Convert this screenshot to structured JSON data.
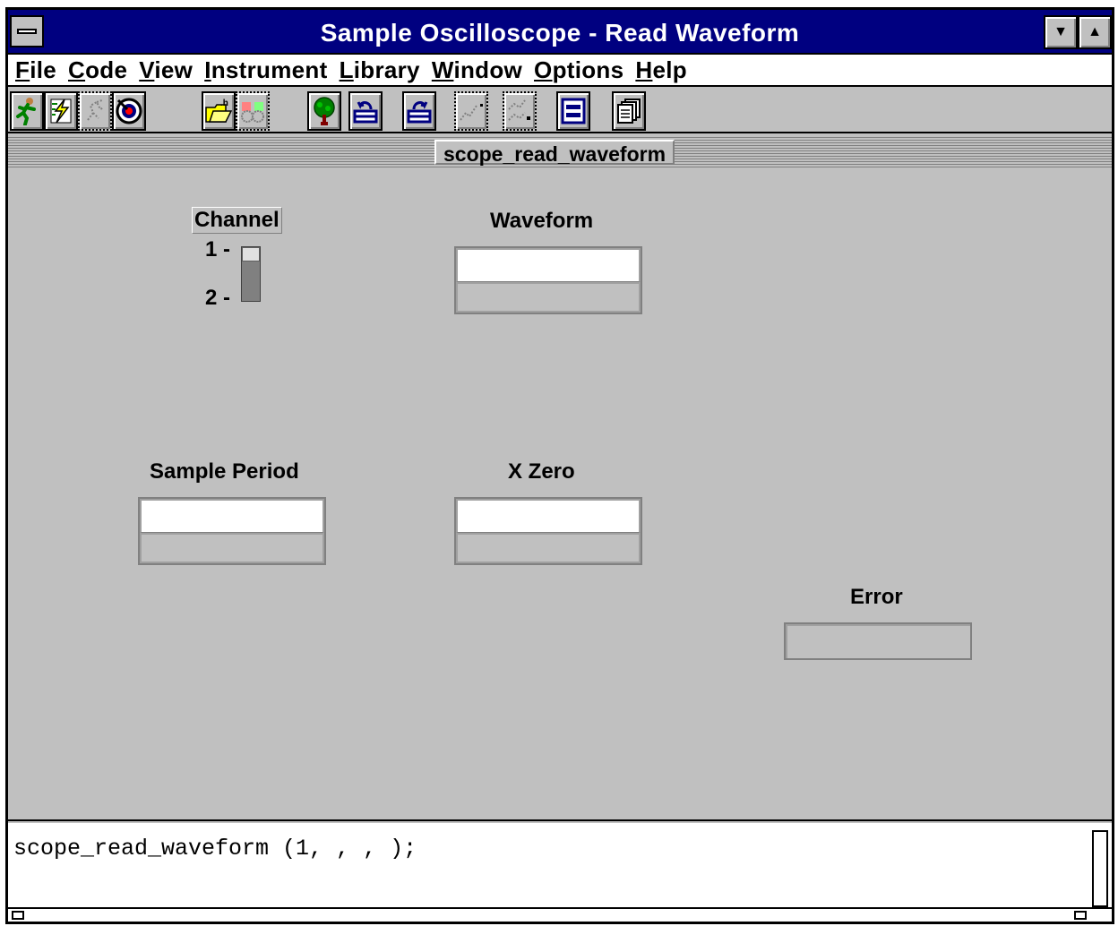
{
  "window": {
    "title": "Sample Oscilloscope - Read Waveform"
  },
  "menubar": {
    "items": [
      {
        "underline": "F",
        "rest": "ile"
      },
      {
        "underline": "C",
        "rest": "ode"
      },
      {
        "underline": "V",
        "rest": "iew"
      },
      {
        "underline": "I",
        "rest": "nstrument"
      },
      {
        "underline": "L",
        "rest": "ibrary"
      },
      {
        "underline": "W",
        "rest": "indow"
      },
      {
        "underline": "O",
        "rest": "ptions"
      },
      {
        "underline": "H",
        "rest": "elp"
      }
    ]
  },
  "toolbar": {
    "icons": [
      "run-icon",
      "lightning-icon",
      "step-icon",
      "target-icon",
      "open-folder-icon",
      "binoculars-icon",
      "tree-icon",
      "upload-icon",
      "download-icon",
      "scatter-icon",
      "scatter-grid-icon",
      "panel-icon",
      "copy-pages-icon"
    ]
  },
  "panel": {
    "title": "scope_read_waveform",
    "channel": {
      "label": "Channel",
      "tick1": "1",
      "tick2": "2",
      "selected": 1
    },
    "waveform": {
      "label": "Waveform"
    },
    "sample_period": {
      "label": "Sample Period"
    },
    "x_zero": {
      "label": "X Zero"
    },
    "error": {
      "label": "Error"
    }
  },
  "code": {
    "text": "scope_read_waveform (1, , , );"
  },
  "colors": {
    "titlebar": "#000080",
    "face": "#c0c0c0",
    "white": "#ffffff"
  }
}
